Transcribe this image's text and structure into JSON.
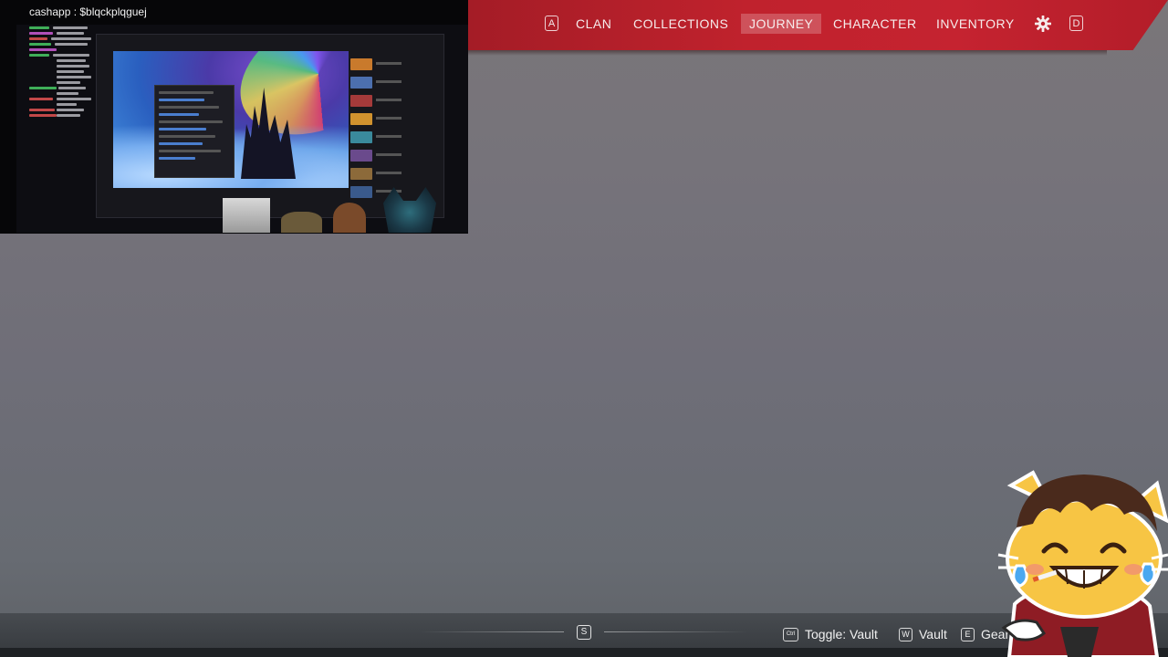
{
  "stream_overlay": {
    "cashapp_label": "cashapp : $blqckplqguej"
  },
  "nav": {
    "left_key": "A",
    "right_key": "D",
    "items": [
      {
        "label": "CLAN"
      },
      {
        "label": "COLLECTIONS"
      },
      {
        "label": "JOURNEY",
        "active": true
      },
      {
        "label": "CHARACTER"
      },
      {
        "label": "INVENTORY"
      }
    ],
    "settings_icon": "gear-icon"
  },
  "bottom_bar": {
    "center_key": "S",
    "hints": [
      {
        "key": "Ctrl",
        "label": "Toggle: Vault"
      },
      {
        "key": "W",
        "label": "Vault"
      },
      {
        "key": "E",
        "label": "Gear"
      }
    ]
  },
  "colors": {
    "nav_red": "#c0222d",
    "background": "#73717a"
  }
}
